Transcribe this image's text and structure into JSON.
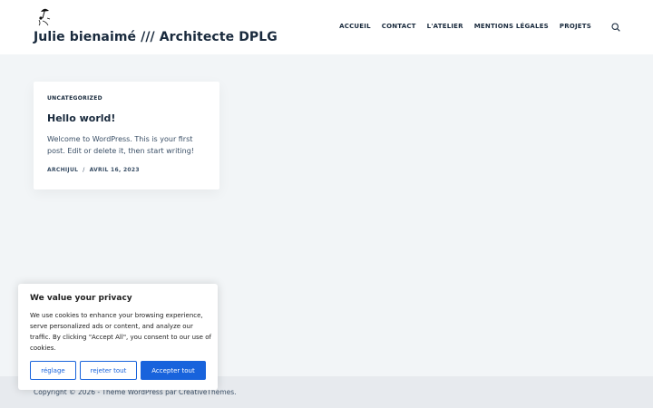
{
  "header": {
    "site_title": "Julie bienaimé /// Architecte DPLG",
    "nav": [
      "ACCUEIL",
      "CONTACT",
      "L'ATELIER",
      "MENTIONS LÉGALES",
      "PROJETS"
    ],
    "logo_icon": "umbrella-figure-logo",
    "search_icon": "search-icon"
  },
  "post": {
    "category": "UNCATEGORIZED",
    "title": "Hello world!",
    "excerpt": "Welcome to WordPress. This is your first post. Edit or delete it, then start writing!",
    "author": "ARCHIJUL",
    "separator": "/",
    "date": "AVRIL 16, 2023"
  },
  "footer": {
    "copyright": "Copyright © 2026 - Thème WordPress par CreativeThemes."
  },
  "cookie": {
    "title": "We value your privacy",
    "text": "We use cookies to enhance your browsing experience, serve personalized ads or content, and analyze our traffic. By clicking \"Accept All\", you consent to our use of cookies.",
    "customize_label": "réglage",
    "reject_label": "rejeter tout",
    "accept_label": "Accepter tout"
  },
  "colors": {
    "accent": "#1863dc",
    "heading": "#192a3d",
    "text": "#3a4f66",
    "background": "#f2f5f7"
  }
}
